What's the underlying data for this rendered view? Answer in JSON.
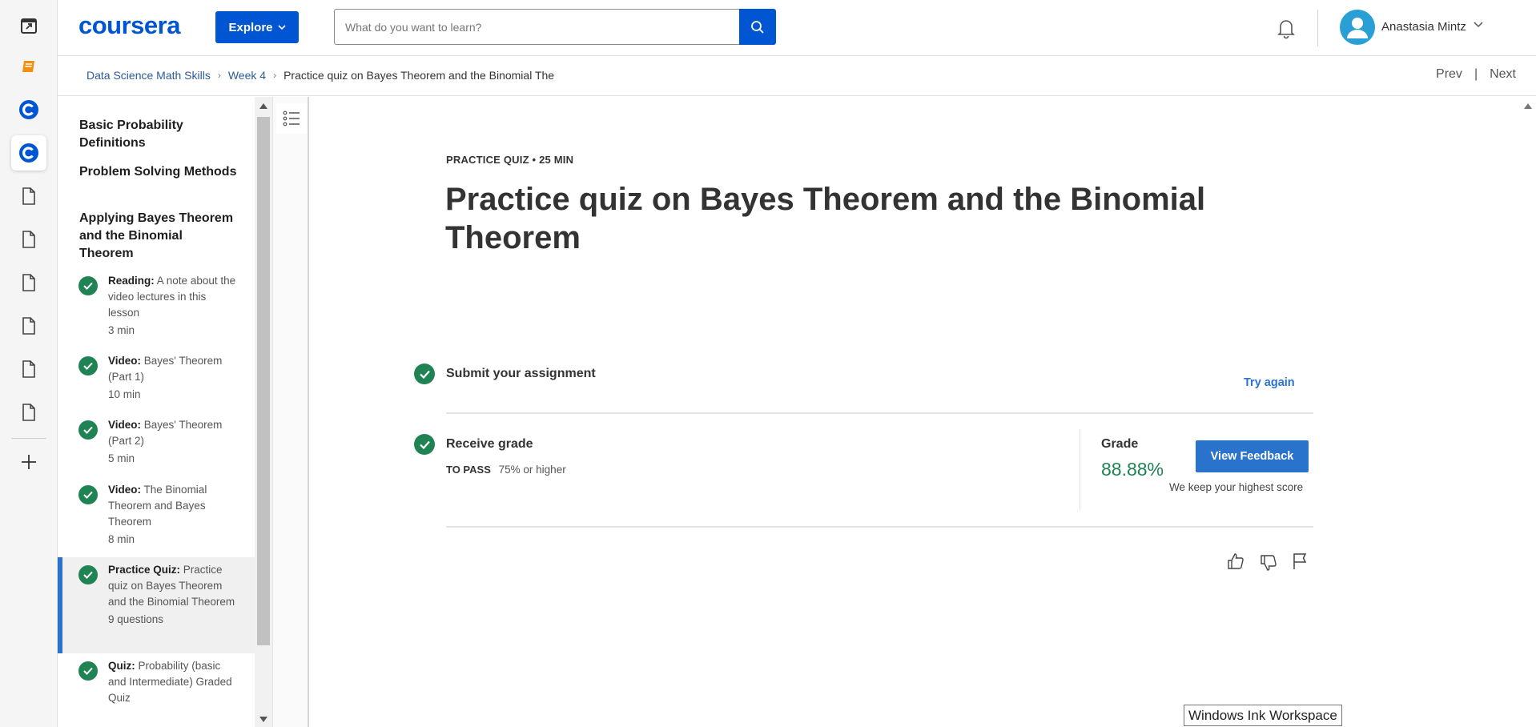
{
  "rail": {
    "icons": [
      "calendar-icon",
      "book-icon",
      "coursera-c-icon",
      "coursera-c-icon",
      "document-icon",
      "document-icon",
      "document-icon",
      "document-icon",
      "document-icon",
      "document-icon",
      "plus-icon"
    ]
  },
  "header": {
    "logo": "coursera",
    "explore_label": "Explore",
    "search_placeholder": "What do you want to learn?",
    "user_name": "Anastasia Mintz",
    "brand_color": "#0056d2"
  },
  "breadcrumb": {
    "items": [
      "Data Science Math Skills",
      "Week 4",
      "Practice quiz on Bayes Theorem and the Binomial The"
    ],
    "prev_label": "Prev",
    "separator": "|",
    "next_label": "Next"
  },
  "sidebar": {
    "sections": [
      "Basic Probability Definitions",
      "Problem Solving Methods",
      "Applying Bayes Theorem and the Binomial Theorem"
    ],
    "items": [
      {
        "type": "Reading:",
        "title": "A note about the video lectures in this lesson",
        "meta": "3 min"
      },
      {
        "type": "Video:",
        "title": "Bayes' Theorem (Part 1)",
        "meta": "10 min"
      },
      {
        "type": "Video:",
        "title": "Bayes' Theorem (Part 2)",
        "meta": "5 min"
      },
      {
        "type": "Video:",
        "title": "The Binomial Theorem and Bayes Theorem",
        "meta": "8 min"
      },
      {
        "type": "Practice Quiz:",
        "title": "Practice quiz on Bayes Theorem and the Binomial Theorem",
        "meta": "9 questions"
      },
      {
        "type": "Quiz:",
        "title": "Probability (basic and Intermediate) Graded Quiz",
        "meta": ""
      }
    ]
  },
  "main": {
    "label": "PRACTICE QUIZ • 25 MIN",
    "title": "Practice quiz on Bayes Theorem and the Binomial Theorem",
    "submit_title": "Submit your assignment",
    "try_again": "Try again",
    "receive_title": "Receive grade",
    "to_pass_label": "TO PASS",
    "to_pass_value": "75% or higher",
    "grade_label": "Grade",
    "grade_value": "88.88%",
    "feedback_button": "View Feedback",
    "keep_note": "We keep your highest score",
    "accent_color": "#2a73cc",
    "success_color": "#1f8354"
  },
  "tooltip": {
    "text": "Windows Ink Workspace"
  }
}
